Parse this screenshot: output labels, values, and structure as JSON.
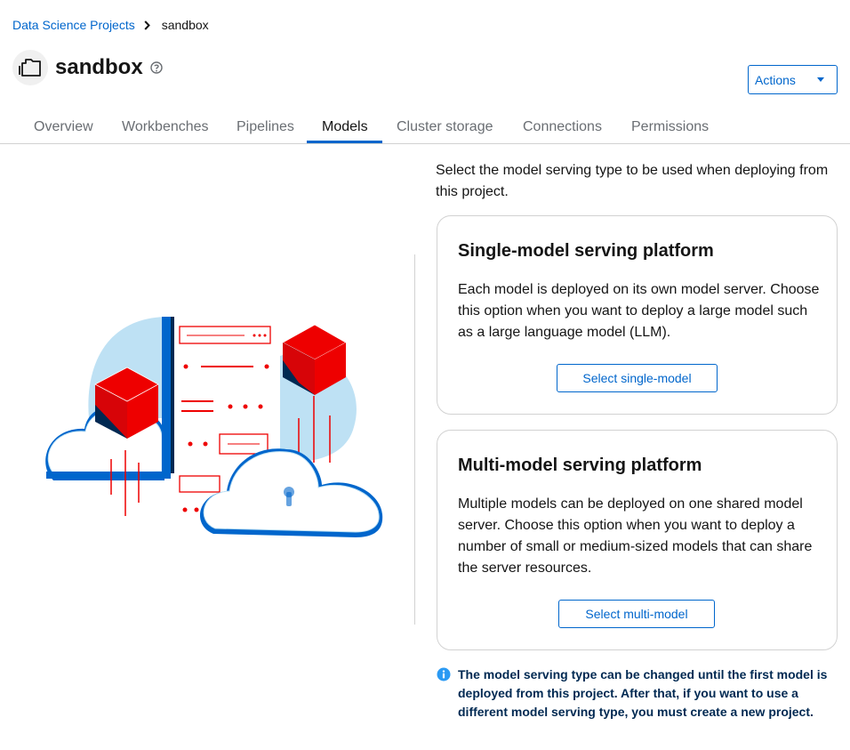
{
  "breadcrumb": {
    "parent": "Data Science Projects",
    "current": "sandbox"
  },
  "header": {
    "title": "sandbox",
    "actions_label": "Actions"
  },
  "tabs": [
    {
      "label": "Overview"
    },
    {
      "label": "Workbenches"
    },
    {
      "label": "Pipelines"
    },
    {
      "label": "Models",
      "active": true
    },
    {
      "label": "Cluster storage"
    },
    {
      "label": "Connections"
    },
    {
      "label": "Permissions"
    }
  ],
  "main": {
    "intro": "Select the model serving type to be used when deploying from this project.",
    "single_model": {
      "title": "Single-model serving platform",
      "description": "Each model is deployed on its own model server. Choose this option when you want to deploy a large model such as a large language model (LLM).",
      "button_label": "Select single-model"
    },
    "multi_model": {
      "title": "Multi-model serving platform",
      "description": "Multiple models can be deployed on one shared model server. Choose this option when you want to deploy a number of small or medium-sized models that can share the server resources.",
      "button_label": "Select multi-model"
    },
    "info_alert": "The model serving type can be changed until the first model is deployed from this project. After that, if you want to use a different model serving type, you must create a new project."
  },
  "icons": {
    "breadcrumb_separator": "chevron-right-icon",
    "project": "project-folder-icon",
    "help": "question-circle-icon",
    "actions_caret": "caret-down-icon",
    "info": "info-circle-icon"
  },
  "colors": {
    "link": "#0066cc",
    "tab_active_underline": "#0066cc",
    "alert_text": "#002952",
    "illustration_red": "#ee0000",
    "illustration_navy": "#002952",
    "illustration_light_blue": "#bee1f4"
  }
}
